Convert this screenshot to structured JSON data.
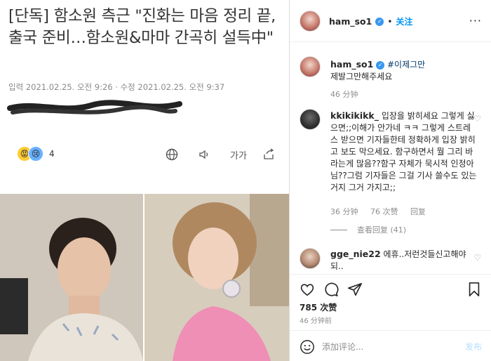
{
  "article": {
    "headline": "[단독] 함소원 측근 \"진화는 마음 정리 끝, 출국 준비…함소원&마마 간곡히 설득中\"",
    "meta": "입력 2021.02.25. 오전 9:26 · 수정 2021.02.25. 오전 9:37",
    "reaction_count": "4",
    "font_size_label": "가가"
  },
  "post": {
    "username": "ham_so1",
    "separator": "•",
    "follow_label": "关注",
    "caption_hashtag": "#이제그만",
    "caption_text": "제발그만해주세요",
    "caption_time": "46 分钟",
    "comments": [
      {
        "username": "kkikikikk_",
        "text": "입장을 밝히세요 그렇게 싫으면;;이해가 안가네 ㅋㅋ 그렇게 스트레스 받으면 기자들한테 정확하게 입장 밝히고 보도 막으세요. 함구하면서 뭘 그리 바라는게 많음??함구 자체가 묵시적 인정아님??그럼 기자들은 그걸 기사 쓸수도 있는거지 그거 가지고;;",
        "time": "36 分钟",
        "likes": "76 次赞",
        "reply": "回复",
        "view_replies": "查看回复 (41)"
      },
      {
        "username": "gge_nie22",
        "text": "에휴..저런것들신고해야되..",
        "time": "",
        "likes": "",
        "reply": ""
      }
    ],
    "likes": "785 次赞",
    "post_time": "46 分钟前",
    "add_comment_placeholder": "添加评论...",
    "post_button": "发布"
  }
}
